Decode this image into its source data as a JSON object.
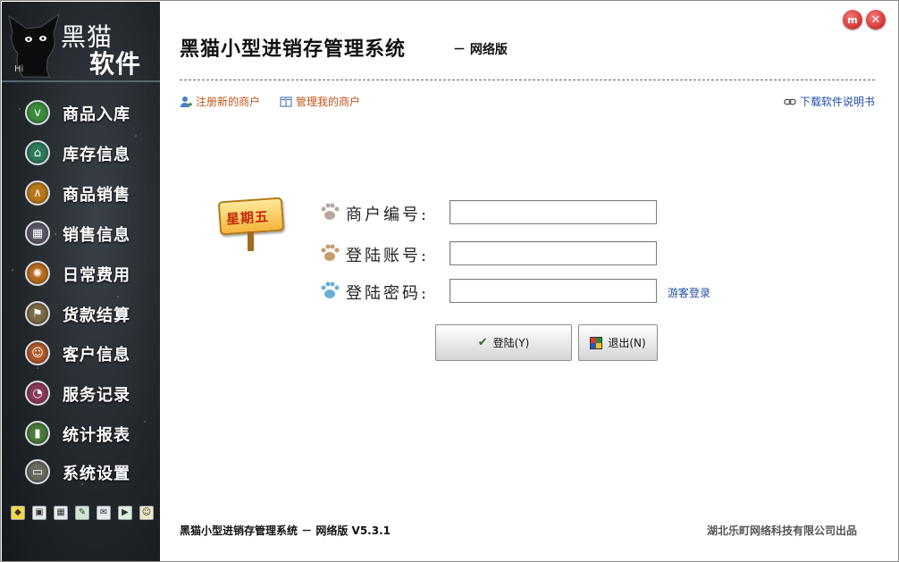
{
  "window": {
    "min_label": "m",
    "close_label": "✕"
  },
  "sidebar": {
    "logo_line1": "黑猫",
    "logo_line2": "软件",
    "logo_hi": "Hi",
    "items": [
      {
        "label": "商品入库",
        "icon": "v",
        "color": "#3d8b3d"
      },
      {
        "label": "库存信息",
        "icon": "⌂",
        "color": "#2f7a5a"
      },
      {
        "label": "商品销售",
        "icon": "∧",
        "color": "#b8791a"
      },
      {
        "label": "销售信息",
        "icon": "▦",
        "color": "#5a5868"
      },
      {
        "label": "日常费用",
        "icon": "✺",
        "color": "#b86a20"
      },
      {
        "label": "货款结算",
        "icon": "⚑",
        "color": "#7a6a46"
      },
      {
        "label": "客户信息",
        "icon": "☺",
        "color": "#b0582c"
      },
      {
        "label": "服务记录",
        "icon": "◔",
        "color": "#8a3a5e"
      },
      {
        "label": "统计报表",
        "icon": "▮",
        "color": "#4a7a3a"
      },
      {
        "label": "系统设置",
        "icon": "▭",
        "color": "#6a6a62"
      }
    ],
    "tools": [
      "◆",
      "▣",
      "▦",
      "✎",
      "✉",
      "▶",
      "☺"
    ]
  },
  "header": {
    "title": "黑猫小型进销存管理系统",
    "subtitle": "－ 网络版"
  },
  "links": {
    "register": "注册新的商户",
    "manage": "管理我的商户",
    "manual": "下载软件说明书"
  },
  "signpost": {
    "text": "星期五"
  },
  "form": {
    "merchant_label": "商户编号:",
    "account_label": "登陆账号:",
    "password_label": "登陆密码:",
    "merchant_value": "",
    "account_value": "",
    "password_value": "",
    "guest_link": "游客登录"
  },
  "buttons": {
    "login": "登陆(Y)",
    "exit": "退出(N)"
  },
  "footer": {
    "left": "黑猫小型进销存管理系统 － 网络版 V5.3.1",
    "right": "湖北乐町网络科技有限公司出品"
  },
  "colors": {
    "sidebar_bg": "#22272c",
    "link_orange": "#c0541a",
    "link_blue": "#1f4ea6",
    "close_red": "#c31515"
  }
}
